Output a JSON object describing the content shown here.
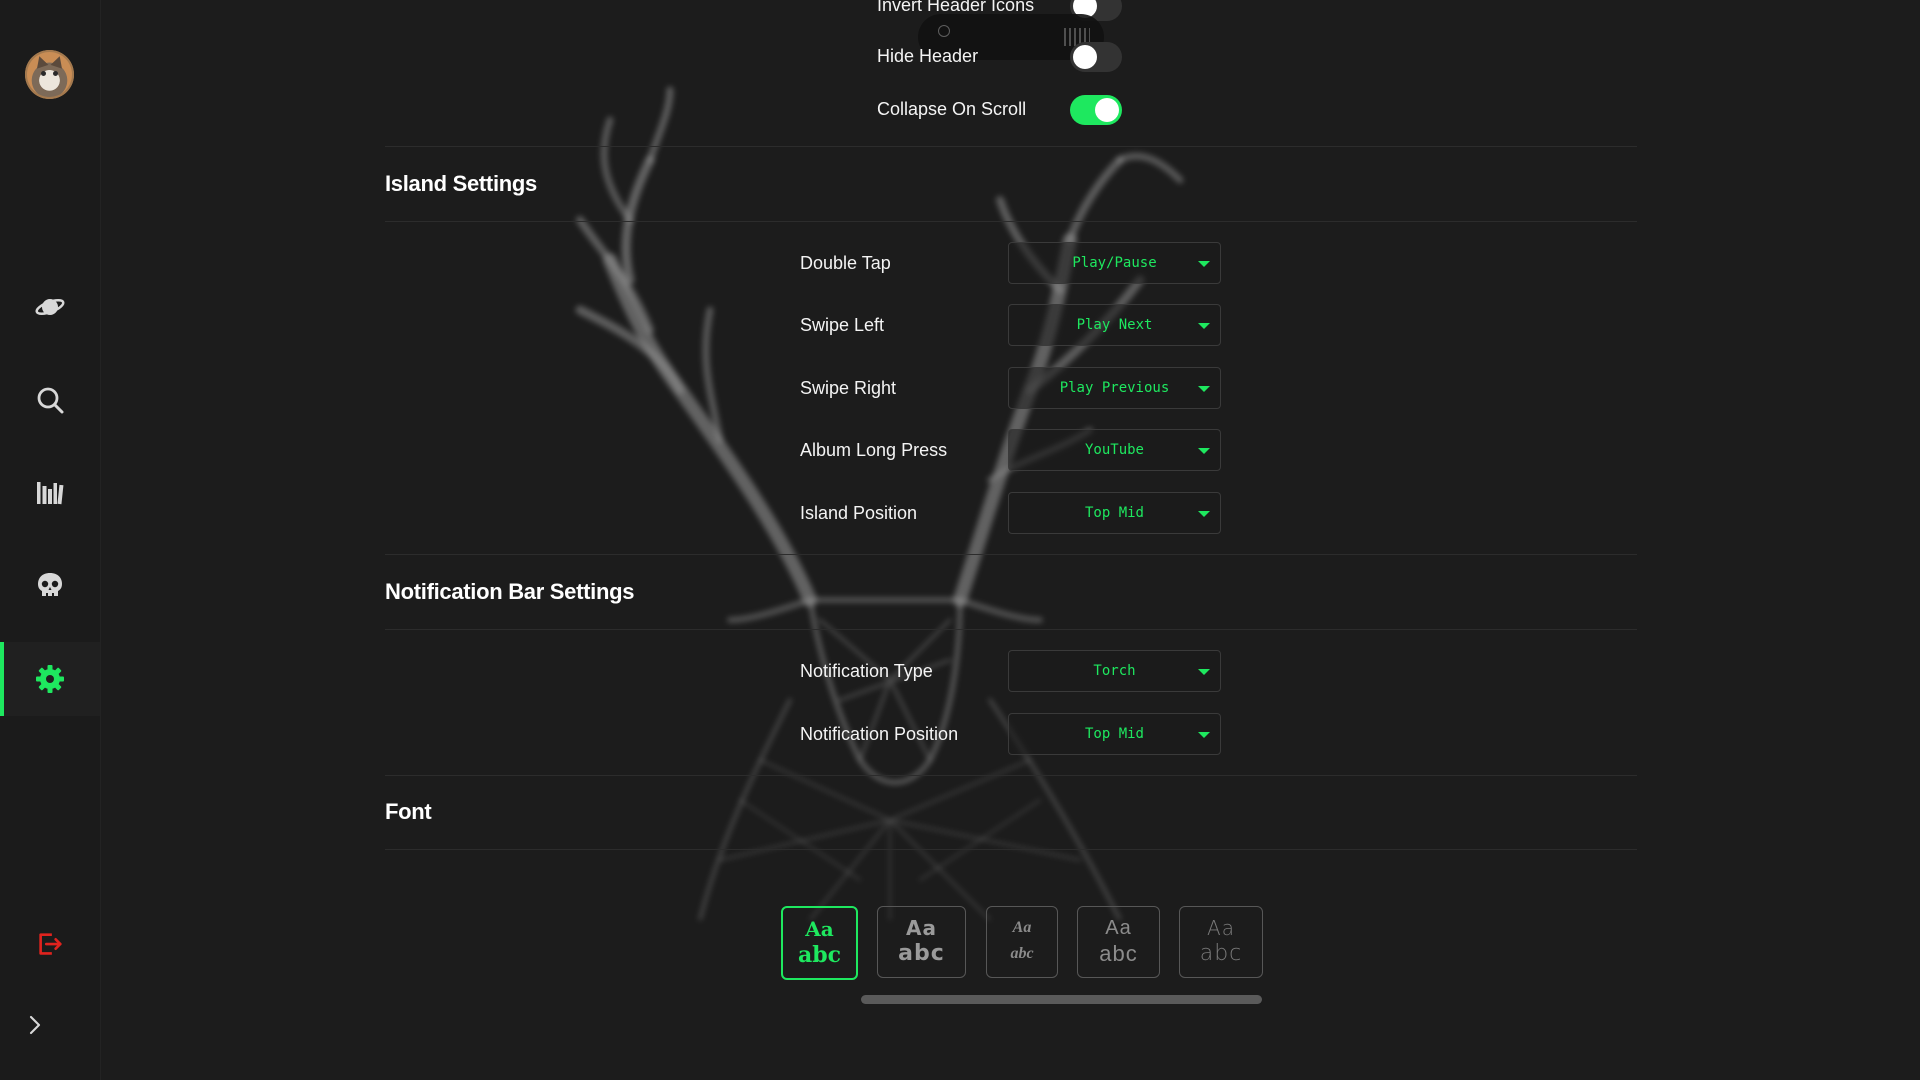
{
  "sidebar": {
    "avatar_alt": "",
    "items": [
      {
        "icon": "planet-icon",
        "active": false
      },
      {
        "icon": "search-icon",
        "active": false
      },
      {
        "icon": "library-icon",
        "active": false
      },
      {
        "icon": "skull-icon",
        "active": false
      },
      {
        "icon": "gear-icon",
        "active": true
      }
    ],
    "logout_icon": "logout-icon",
    "expand_icon": "chevron-right-icon"
  },
  "header_settings": {
    "toggles": [
      {
        "label": "Invert Header Icons",
        "on": false
      },
      {
        "label": "Hide Header",
        "on": false
      },
      {
        "label": "Collapse On Scroll",
        "on": true
      }
    ]
  },
  "island_settings": {
    "title": "Island Settings",
    "rows": [
      {
        "label": "Double Tap",
        "value": "Play/Pause"
      },
      {
        "label": "Swipe Left",
        "value": "Play Next"
      },
      {
        "label": "Swipe Right",
        "value": "Play Previous"
      },
      {
        "label": "Album Long Press",
        "value": "YouTube"
      },
      {
        "label": "Island Position",
        "value": "Top Mid"
      }
    ]
  },
  "notification_settings": {
    "title": "Notification Bar Settings",
    "rows": [
      {
        "label": "Notification Type",
        "value": "Torch"
      },
      {
        "label": "Notification Position",
        "value": "Top Mid"
      }
    ]
  },
  "font": {
    "title": "Font",
    "tiles": [
      {
        "aa": "Aa",
        "abc": "abc",
        "selected": true
      },
      {
        "aa": "Aa",
        "abc": "abc",
        "selected": false
      },
      {
        "aa": "Aa",
        "abc": "abc",
        "selected": false
      },
      {
        "aa": "Aa",
        "abc": "abc",
        "selected": false
      },
      {
        "aa": "Aa",
        "abc": "abc",
        "selected": false
      }
    ]
  },
  "colors": {
    "accent": "#1ee85f",
    "background": "#1c1c1c",
    "logout": "#e0231e"
  }
}
